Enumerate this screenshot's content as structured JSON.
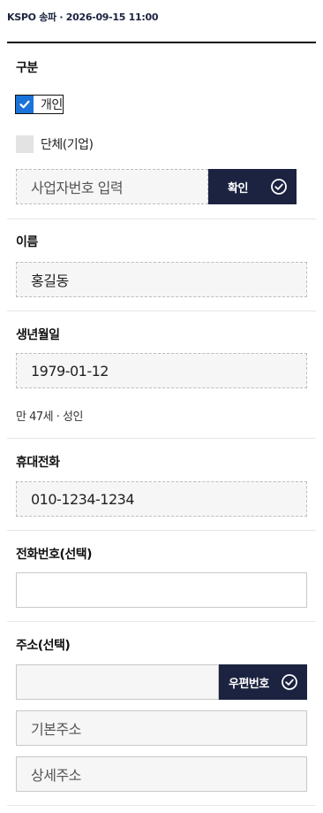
{
  "header": {
    "title": "KSPO 송파 · 2026-09-15 11:00"
  },
  "division": {
    "label": "구분",
    "options": [
      {
        "label": "개인",
        "checked": true
      },
      {
        "label": "단체(기업)",
        "checked": false
      }
    ],
    "business_number": {
      "placeholder": "사업자번호 입력",
      "confirm_label": "확인"
    }
  },
  "name": {
    "label": "이름",
    "value": "홍길동"
  },
  "birthdate": {
    "label": "생년월일",
    "value": "1979-01-12",
    "age_note": "만 47세 · 성인"
  },
  "mobile": {
    "label": "휴대전화",
    "value": "010-1234-1234"
  },
  "phone": {
    "label": "전화번호(선택)",
    "value": ""
  },
  "address": {
    "label": "주소(선택)",
    "postcode_value": "",
    "postcode_button": "우편번호",
    "basic_placeholder": "기본주소",
    "detail_placeholder": "상세주소"
  },
  "colors": {
    "accent_dark": "#1c2340",
    "checkbox_blue": "#1a73d9"
  }
}
